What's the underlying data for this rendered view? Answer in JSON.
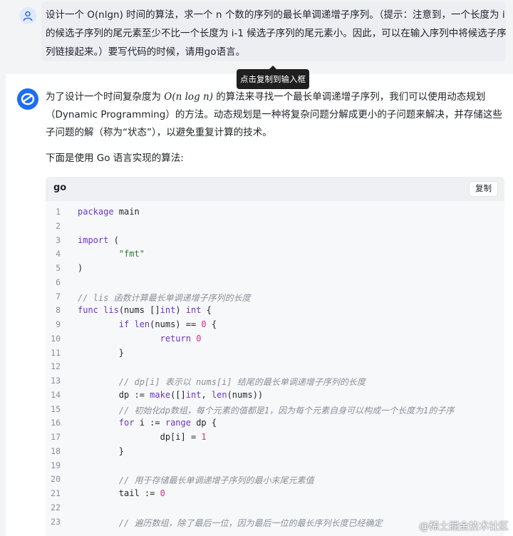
{
  "user": {
    "question": "设计一个 O(nlgn) 时间的算法，求一个 n 个数的序列的最长单调递增子序列。（提示：注意到，一个长度为 i 的候选子序列的尾元素至少不比一个长度为 i-1 候选子序列的尾元素小。因此，可以在输入序列中将候选子序列链接起来。）要写代码的时候，请用go语言。"
  },
  "tooltip": "点击复制到输入框",
  "answer": {
    "intro_pre": "为了设计一个时间复杂度为 ",
    "intro_math": "O(n log n)",
    "intro_post": " 的算法来寻找一个最长单调递增子序列，我们可以使用动态规划（Dynamic Programming）的方法。动态规划是一种将复杂问题分解成更小的子问题来解决，并存储这些子问题的解（称为“状态”），以避免重复计算的技术。",
    "go_intro": "下面是使用 Go 语言实现的算法:"
  },
  "code": {
    "language": "go",
    "copy_label": "复制",
    "lines": [
      {
        "n": "1",
        "text": "package main"
      },
      {
        "n": "2",
        "text": ""
      },
      {
        "n": "3",
        "text": "import ("
      },
      {
        "n": "4",
        "text": "        \"fmt\""
      },
      {
        "n": "5",
        "text": ")"
      },
      {
        "n": "6",
        "text": ""
      },
      {
        "n": "7",
        "text": "// lis 函数计算最长单调递增子序列的长度"
      },
      {
        "n": "8",
        "text": "func lis(nums []int) int {"
      },
      {
        "n": "9",
        "text": "        if len(nums) == 0 {"
      },
      {
        "n": "10",
        "text": "                return 0"
      },
      {
        "n": "11",
        "text": "        }"
      },
      {
        "n": "12",
        "text": ""
      },
      {
        "n": "13",
        "text": "        // dp[i] 表示以 nums[i] 结尾的最长单调递增子序列的长度"
      },
      {
        "n": "14",
        "text": "        dp := make([]int, len(nums))"
      },
      {
        "n": "15",
        "text": "        // 初始化dp数组，每个元素的值都是1，因为每个元素自身可以构成一个长度为1的子序"
      },
      {
        "n": "16",
        "text": "        for i := range dp {"
      },
      {
        "n": "17",
        "text": "                dp[i] = 1"
      },
      {
        "n": "18",
        "text": "        }"
      },
      {
        "n": "19",
        "text": ""
      },
      {
        "n": "20",
        "text": "        // 用于存储最长单调递增子序列的最小末尾元素值"
      },
      {
        "n": "21",
        "text": "        tail := 0"
      },
      {
        "n": "22",
        "text": ""
      },
      {
        "n": "23",
        "text": "        // 遍历数组，除了最后一位，因为最后一位的最长序列长度已经确定"
      }
    ]
  },
  "watermark": "@稀土掘金技术社区"
}
